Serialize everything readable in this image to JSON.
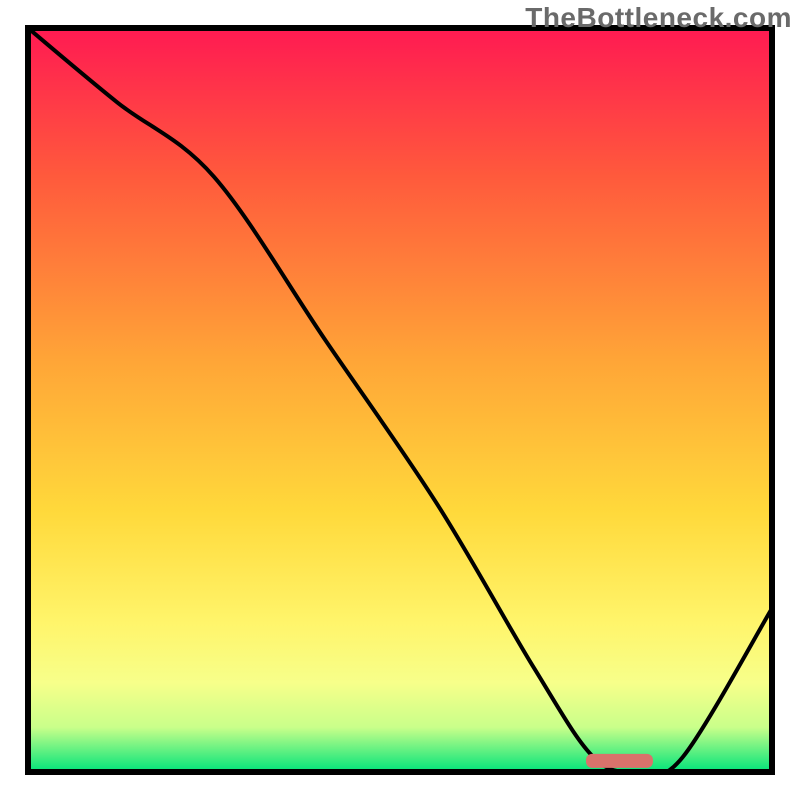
{
  "watermark": "TheBottleneck.com",
  "chart_data": {
    "type": "line",
    "title": "",
    "xlabel": "",
    "ylabel": "",
    "xlim": [
      0,
      100
    ],
    "ylim": [
      0,
      100
    ],
    "grid": false,
    "legend": false,
    "series": [
      {
        "name": "bottleneck-curve",
        "x": [
          0,
          12,
          25,
          40,
          55,
          68,
          76,
          82,
          88,
          100
        ],
        "y": [
          100,
          90,
          80,
          58,
          36,
          14,
          2,
          0,
          2,
          22
        ]
      }
    ],
    "marker": {
      "name": "optimal-range",
      "x_start": 75,
      "x_end": 84,
      "y": 1.5,
      "color": "#d9726b"
    },
    "gradient_stops": [
      {
        "offset": 0.0,
        "color": "#ff1a52"
      },
      {
        "offset": 0.2,
        "color": "#ff5a3c"
      },
      {
        "offset": 0.45,
        "color": "#ffa637"
      },
      {
        "offset": 0.65,
        "color": "#ffd93b"
      },
      {
        "offset": 0.8,
        "color": "#fff56b"
      },
      {
        "offset": 0.88,
        "color": "#f7ff8a"
      },
      {
        "offset": 0.94,
        "color": "#c9ff8a"
      },
      {
        "offset": 1.0,
        "color": "#00e37a"
      }
    ],
    "frame": {
      "stroke": "#000000",
      "stroke_width": 6
    }
  }
}
